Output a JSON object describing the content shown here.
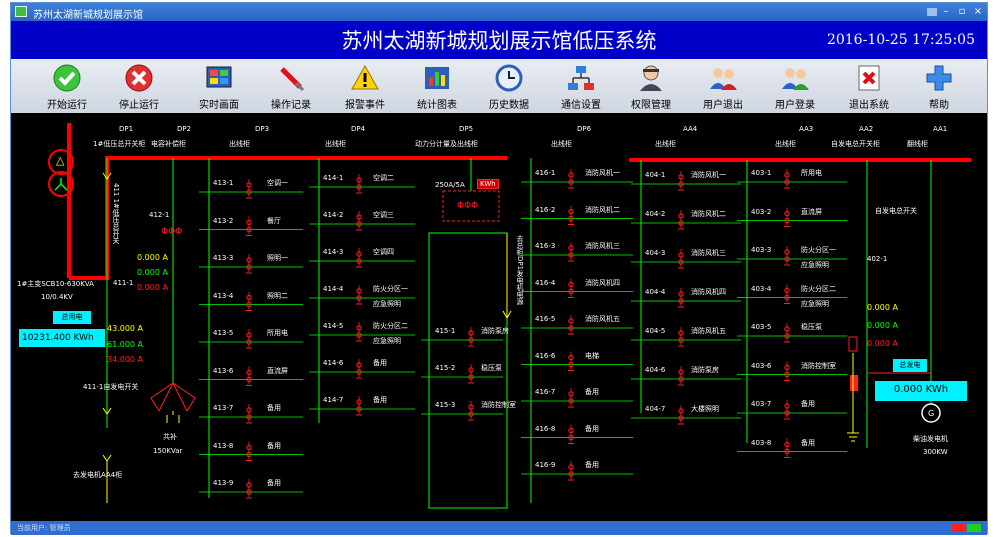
{
  "window": {
    "title": "苏州太湖新城规划展示馆"
  },
  "header": {
    "title": "苏州太湖新城规划展示馆低压系统",
    "datetime": "2016-10-25  17:25:05"
  },
  "toolbar": [
    {
      "label": "开始运行",
      "icon": "start-run-icon"
    },
    {
      "label": "停止运行",
      "icon": "stop-run-icon"
    },
    {
      "label": "实时画面",
      "icon": "realtime-screen-icon"
    },
    {
      "label": "操作记录",
      "icon": "operation-log-icon"
    },
    {
      "label": "报警事件",
      "icon": "alarm-event-icon"
    },
    {
      "label": "统计图表",
      "icon": "statistics-chart-icon"
    },
    {
      "label": "历史数据",
      "icon": "history-data-icon"
    },
    {
      "label": "通信设置",
      "icon": "comm-settings-icon"
    },
    {
      "label": "权限管理",
      "icon": "permission-icon"
    },
    {
      "label": "用户退出",
      "icon": "user-logout-icon"
    },
    {
      "label": "用户登录",
      "icon": "user-login-icon"
    },
    {
      "label": "退出系统",
      "icon": "exit-system-icon"
    },
    {
      "label": "帮助",
      "icon": "help-icon"
    }
  ],
  "cabinets": [
    {
      "code": "DP1",
      "name": "1#低压总开关柜"
    },
    {
      "code": "DP2",
      "name": "电容补偿柜"
    },
    {
      "code": "DP3",
      "name": "出线柜"
    },
    {
      "code": "DP4",
      "name": "出线柜"
    },
    {
      "code": "DP5",
      "name": "动力分计量及出线柜"
    },
    {
      "code": "DP6",
      "name": "出线柜"
    },
    {
      "code": "AA4",
      "name": "出线柜"
    },
    {
      "code": "AA3",
      "name": "出线柜"
    },
    {
      "code": "AA2",
      "name": "自发电总开关柜"
    },
    {
      "code": "AA1",
      "name": "翻线柜"
    }
  ],
  "transformer": {
    "name": "1#主变SCB10-630KVA",
    "ratio": "10/0.4KV"
  },
  "main": {
    "vertical_label": "411 1#低压总开关",
    "switch_id": "411-1",
    "total_label": "总用电",
    "total_kwh": "10231.400 KWh",
    "currents": [
      "43.000 A",
      "61.000 A",
      "34.000 A"
    ],
    "genset_switch": "411-1自发电开关",
    "to_generator": "去发电机AA4柜"
  },
  "capacitor": {
    "switch_id": "412-1",
    "currents": [
      "0.000 A",
      "0.000 A",
      "0.000 A"
    ],
    "label": "共补",
    "rating": "150KVar"
  },
  "dp3_feeders": [
    {
      "id": "413-1",
      "name": "空调一"
    },
    {
      "id": "413-2",
      "name": "餐厅"
    },
    {
      "id": "413-3",
      "name": "照明一"
    },
    {
      "id": "413-4",
      "name": "照明二"
    },
    {
      "id": "413-5",
      "name": "所用电"
    },
    {
      "id": "413-6",
      "name": "直流屏"
    },
    {
      "id": "413-7",
      "name": "备用"
    },
    {
      "id": "413-8",
      "name": "备用"
    },
    {
      "id": "413-9",
      "name": "备用"
    }
  ],
  "dp4_feeders": [
    {
      "id": "414-1",
      "name": "空调二"
    },
    {
      "id": "414-2",
      "name": "空调三"
    },
    {
      "id": "414-3",
      "name": "空调四"
    },
    {
      "id": "414-4",
      "name": "防火分区一",
      "sub": "应急照明"
    },
    {
      "id": "414-5",
      "name": "防火分区二",
      "sub": "应急照明"
    },
    {
      "id": "414-6",
      "name": "备用"
    },
    {
      "id": "414-7",
      "name": "备用"
    }
  ],
  "dp5": {
    "meter": "250A/5A",
    "kwh_tag": "KWh",
    "vertical_label": "去总柜DP1发电机电源",
    "feeders": [
      {
        "id": "415-1",
        "name": "消防泵房"
      },
      {
        "id": "415-2",
        "name": "稳压泵"
      },
      {
        "id": "415-3",
        "name": "消防控制室"
      }
    ]
  },
  "dp6_feeders": [
    {
      "id": "416-1",
      "name": "消防风机一"
    },
    {
      "id": "416-2",
      "name": "消防风机二"
    },
    {
      "id": "416-3",
      "name": "消防风机三"
    },
    {
      "id": "416-4",
      "name": "消防风机四"
    },
    {
      "id": "416-5",
      "name": "消防风机五"
    },
    {
      "id": "416-6",
      "name": "电梯"
    },
    {
      "id": "416-7",
      "name": "备用"
    },
    {
      "id": "416-8",
      "name": "备用"
    },
    {
      "id": "416-9",
      "name": "备用"
    }
  ],
  "aa4_feeders": [
    {
      "id": "404-1",
      "name": "消防风机一"
    },
    {
      "id": "404-2",
      "name": "消防风机二"
    },
    {
      "id": "404-3",
      "name": "消防风机三"
    },
    {
      "id": "404-4",
      "name": "消防风机四"
    },
    {
      "id": "404-5",
      "name": "消防风机五"
    },
    {
      "id": "404-6",
      "name": "消防泵房"
    },
    {
      "id": "404-7",
      "name": "大楼照明"
    }
  ],
  "aa3_feeders": [
    {
      "id": "403-1",
      "name": "所用电"
    },
    {
      "id": "403-2",
      "name": "直流屏"
    },
    {
      "id": "403-3",
      "name": "防火分区一",
      "sub": "应急照明"
    },
    {
      "id": "403-4",
      "name": "防火分区二",
      "sub": "应急照明"
    },
    {
      "id": "403-5",
      "name": "稳压泵"
    },
    {
      "id": "403-6",
      "name": "消防控制室"
    },
    {
      "id": "403-7",
      "name": "备用"
    },
    {
      "id": "403-8",
      "name": "备用"
    }
  ],
  "aa2": {
    "switch_label": "自发电总开关",
    "switch_id": "402-1",
    "currents": [
      "0.000 A",
      "0.000 A",
      "0.000 A"
    ],
    "gen_label": "总发电",
    "gen_kwh": "0.000 KWh",
    "generator_symbol": "G",
    "generator_name": "柴油发电机",
    "generator_rating": "300KW"
  },
  "transformer_symbol": "△",
  "statusbar": {
    "text": "当前用户: 管理员"
  },
  "colors": {
    "busbar": "#ff0000",
    "line": "#00ff00",
    "switch": "#ff2020",
    "kwh_box": "#00f0ff",
    "title_bg": "#0000c8"
  }
}
